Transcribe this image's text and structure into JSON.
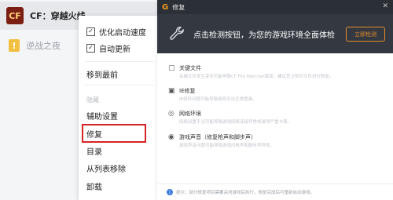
{
  "launcher": {
    "games": [
      {
        "logo": "CF",
        "name": "CF：穿越火线"
      },
      {
        "logo": "!",
        "name": "逆战之夜"
      }
    ]
  },
  "context_menu": {
    "items": [
      {
        "label": "优化启动速度",
        "checked": "✓"
      },
      {
        "label": "自动更新",
        "checked": "✓"
      },
      {
        "label": "移到最前"
      },
      {
        "label": "隐藏"
      },
      {
        "label": "辅助设置"
      },
      {
        "label": "修复"
      },
      {
        "label": "目录"
      },
      {
        "label": "从列表移除"
      },
      {
        "label": "卸载"
      }
    ]
  },
  "dialog": {
    "title": "修复",
    "close": "✕",
    "banner_text": "点击检测按钮，为您的游戏环境全面体检",
    "repair_button": "立即检测",
    "checks": [
      {
        "title": "关键文件",
        "desc": "关键文件发生变化可能导致CF File Watcher错误，建议您立即对文件进行修复。"
      },
      {
        "title": "IE修复",
        "desc": "IE组件问题可能导致游戏无法正常登录。"
      },
      {
        "title": "网络环境",
        "desc": "网络设置不当可能导致游戏网络连接异常或游戏严重卡顿。"
      },
      {
        "title": "游戏声音（修复枪声和脚步声）",
        "desc": "游戏声音问题可能导致游戏内枪声和脚步声异常。"
      }
    ],
    "footer": "提示：部分修复项目需要关闭游戏后执行，修复完成后可重新启动游戏。"
  }
}
